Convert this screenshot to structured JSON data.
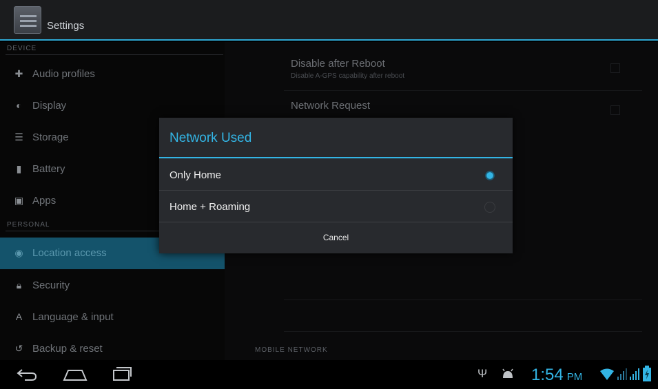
{
  "header": {
    "title": "Settings"
  },
  "sidebar": {
    "device_header": "DEVICE",
    "personal_header": "PERSONAL",
    "items": [
      {
        "label": "Audio profiles",
        "icon": "audio-profiles-icon"
      },
      {
        "label": "Display",
        "icon": "display-icon"
      },
      {
        "label": "Storage",
        "icon": "storage-icon"
      },
      {
        "label": "Battery",
        "icon": "battery-icon"
      },
      {
        "label": "Apps",
        "icon": "apps-icon"
      },
      {
        "label": "Location access",
        "icon": "location-icon",
        "selected": true
      },
      {
        "label": "Security",
        "icon": "lock-icon"
      },
      {
        "label": "Language & input",
        "icon": "language-icon"
      },
      {
        "label": "Backup & reset",
        "icon": "backup-icon"
      }
    ]
  },
  "main": {
    "prefs": [
      {
        "title": "Disable after Reboot",
        "summary": "Disable A-GPS capability after reboot"
      },
      {
        "title": "Network Request",
        "summary": ""
      }
    ],
    "mobile_network_header": "MOBILE NETWORK"
  },
  "dialog": {
    "title": "Network Used",
    "options": [
      {
        "label": "Only Home",
        "selected": true
      },
      {
        "label": "Home + Roaming",
        "selected": false
      }
    ],
    "cancel_label": "Cancel"
  },
  "status_bar": {
    "time": "1:54",
    "ampm": "PM",
    "accent_color": "#33b5e5"
  }
}
